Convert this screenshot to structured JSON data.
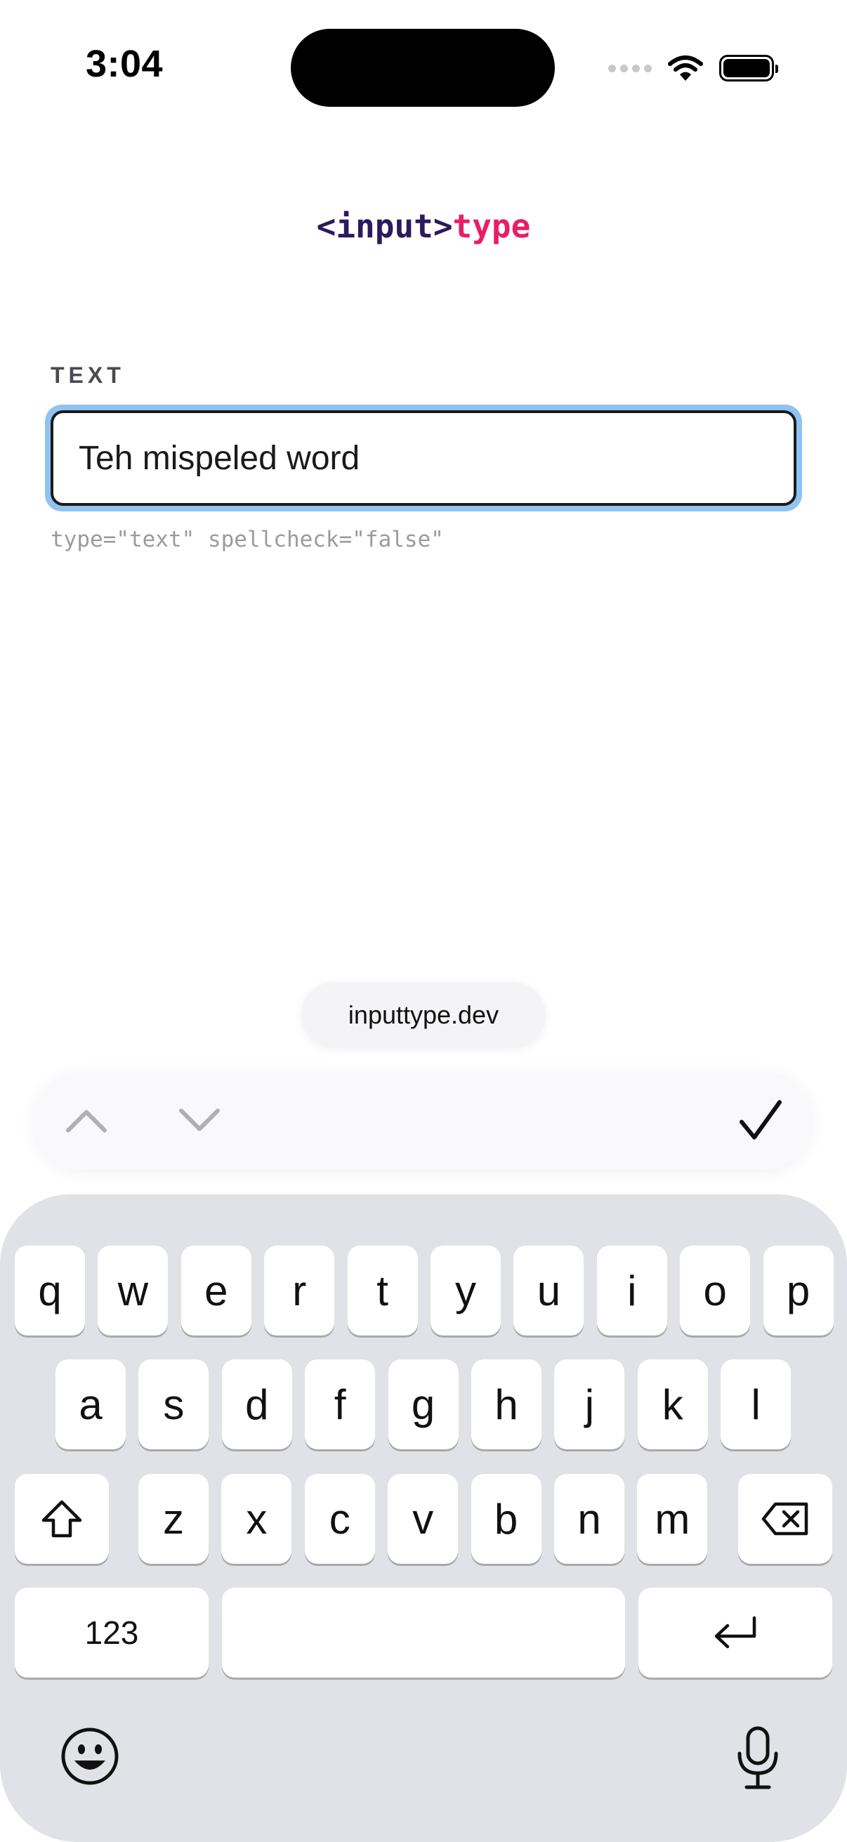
{
  "status_bar": {
    "time": "3:04",
    "icons": [
      "signal-dots-icon",
      "wifi-icon",
      "battery-icon"
    ]
  },
  "logo": {
    "tag_text": "<input>",
    "type_text": "type"
  },
  "field": {
    "label": "TEXT",
    "value": "Teh mispeled word",
    "hint": "type=\"text\" spellcheck=\"false\""
  },
  "url_pill": {
    "text": "inputtype.dev"
  },
  "accessory_bar": {
    "icons": [
      "chevron-up-icon",
      "chevron-down-icon",
      "checkmark-icon"
    ]
  },
  "keyboard": {
    "row1": [
      "q",
      "w",
      "e",
      "r",
      "t",
      "y",
      "u",
      "i",
      "o",
      "p"
    ],
    "row2": [
      "a",
      "s",
      "d",
      "f",
      "g",
      "h",
      "j",
      "k",
      "l"
    ],
    "row3": [
      "z",
      "x",
      "c",
      "v",
      "b",
      "n",
      "m"
    ],
    "numbers_key": "123",
    "space_key": "",
    "icons": [
      "shift-icon",
      "delete-icon",
      "return-icon",
      "emoji-icon",
      "microphone-icon"
    ]
  },
  "colors": {
    "logo_tag": "#2a1a5e",
    "logo_type": "#e91e63",
    "focus_ring": "#8fc3f0",
    "keyboard_bg": "#e1e2e7"
  }
}
